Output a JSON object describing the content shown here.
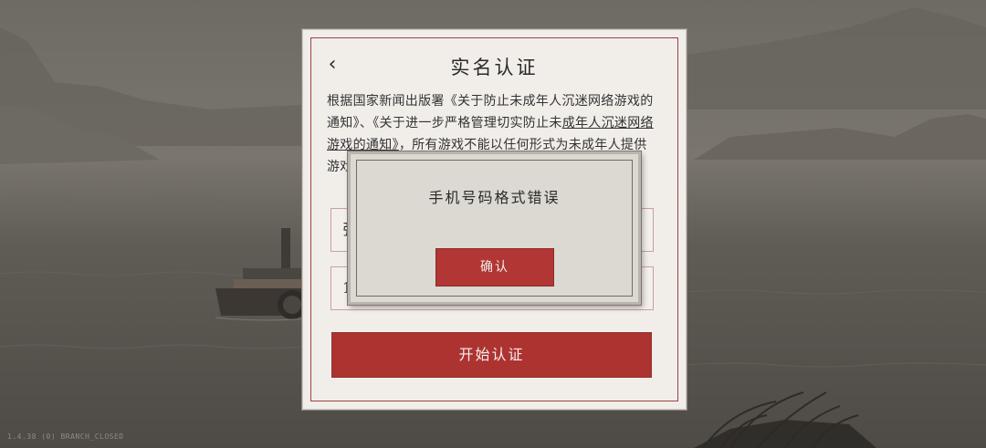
{
  "card": {
    "back_icon": "chevron-left-icon",
    "back_glyph": "‹",
    "title": "实名认证",
    "notice_prefix": "根据国家新闻出版署《关于防止未成年人沉迷网络游戏的通知》、《关于进一步严格管理切实防止未",
    "notice_link": "成年人沉迷网络游戏的通知》",
    "notice_suffix": "，所有游戏不能以任何形式为未成年人提供游戏服务，请尽快完成实名认证，未进行",
    "name_field_value": "张",
    "id_field_value": "1",
    "start_button": "开始认证"
  },
  "modal": {
    "message": "手机号码格式错误",
    "confirm_button": "确认"
  },
  "version": "1.4.38 (0) BRANCH_CLOSED",
  "colors": {
    "accent_red": "#ad3331",
    "card_bg": "#f1eeea",
    "modal_bg": "#dcd9d3",
    "scene_bg": "#5f5c55"
  }
}
